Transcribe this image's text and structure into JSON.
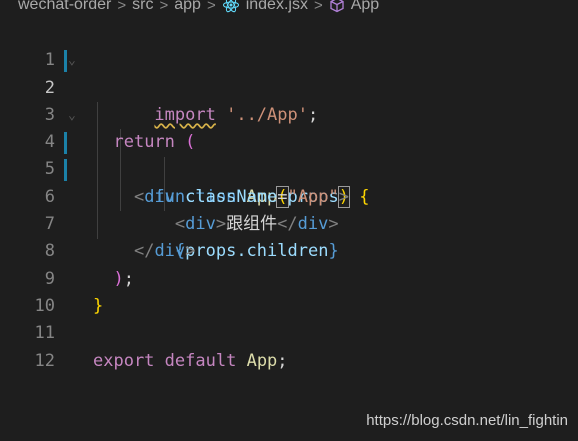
{
  "breadcrumb": {
    "items": [
      "wechat-order",
      "src",
      "app",
      "index.jsx",
      "App"
    ],
    "separator": ">"
  },
  "editor": {
    "line_numbers": [
      "1",
      "2",
      "3",
      "4",
      "5",
      "6",
      "7",
      "8",
      "9",
      "10",
      "11",
      "12"
    ],
    "active_line": "2",
    "code": {
      "l1_import": "import",
      "l1_path": "'../App'",
      "l1_semi": ";",
      "l2_function": "function",
      "l2_name": "App",
      "l2_open_paren": "(",
      "l2_param": "props",
      "l2_close_paren": ")",
      "l2_brace": "{",
      "l3_return": "return",
      "l3_paren": "(",
      "l4_lt": "<",
      "l4_tag": "div",
      "l4_attr": "className",
      "l4_eq": "=",
      "l4_val": "\"App\"",
      "l4_gt": ">",
      "l5_open": "<",
      "l5_tag": "div",
      "l5_gt": ">",
      "l5_text": "跟组件",
      "l5_close_lt": "</",
      "l5_close_tag": "div",
      "l5_close_gt": ">",
      "l6_open": "{",
      "l6_expr": "props.children",
      "l6_close": "}",
      "l7_lt": "</",
      "l7_tag": "div",
      "l7_gt": ">",
      "l8_paren": ")",
      "l8_semi": ";",
      "l9_brace": "}",
      "l11_export": "export",
      "l11_default": "default",
      "l11_name": "App",
      "l11_semi": ";"
    }
  },
  "watermark": "https://blog.csdn.net/lin_fightin",
  "colors": {
    "background": "#1e1e1e",
    "keyword_flow": "#c586c0",
    "keyword": "#569cd6",
    "function": "#dcdcaa",
    "string": "#ce9178",
    "variable": "#9cdcfe",
    "modified_gutter": "#1b81a8"
  },
  "icons": [
    "react-icon",
    "cube-icon"
  ]
}
